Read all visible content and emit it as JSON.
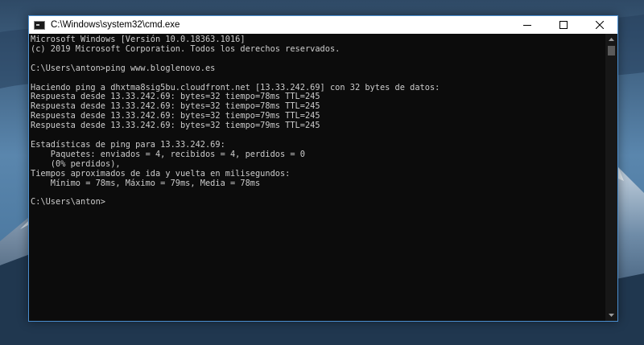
{
  "window": {
    "title": "C:\\Windows\\system32\\cmd.exe",
    "accent_color": "#4b8fd0",
    "console_bg": "#0c0c0c",
    "console_fg": "#cccccc"
  },
  "console": {
    "lines": [
      "Microsoft Windows [Versión 10.0.18363.1016]",
      "(c) 2019 Microsoft Corporation. Todos los derechos reservados.",
      "",
      "C:\\Users\\anton>ping www.bloglenovo.es",
      "",
      "Haciendo ping a dhxtma8sig5bu.cloudfront.net [13.33.242.69] con 32 bytes de datos:",
      "Respuesta desde 13.33.242.69: bytes=32 tiempo=78ms TTL=245",
      "Respuesta desde 13.33.242.69: bytes=32 tiempo=78ms TTL=245",
      "Respuesta desde 13.33.242.69: bytes=32 tiempo=79ms TTL=245",
      "Respuesta desde 13.33.242.69: bytes=32 tiempo=79ms TTL=245",
      "",
      "Estadísticas de ping para 13.33.242.69:",
      "    Paquetes: enviados = 4, recibidos = 4, perdidos = 0",
      "    (0% perdidos),",
      "Tiempos aproximados de ida y vuelta en milisegundos:",
      "    Mínimo = 78ms, Máximo = 79ms, Media = 78ms",
      "",
      "C:\\Users\\anton>"
    ]
  },
  "icons": {
    "app": "cmd-icon",
    "minimize": "minimize-icon",
    "maximize": "maximize-icon",
    "close": "close-icon",
    "scroll_up": "arrow-up-icon",
    "scroll_down": "arrow-down-icon"
  }
}
